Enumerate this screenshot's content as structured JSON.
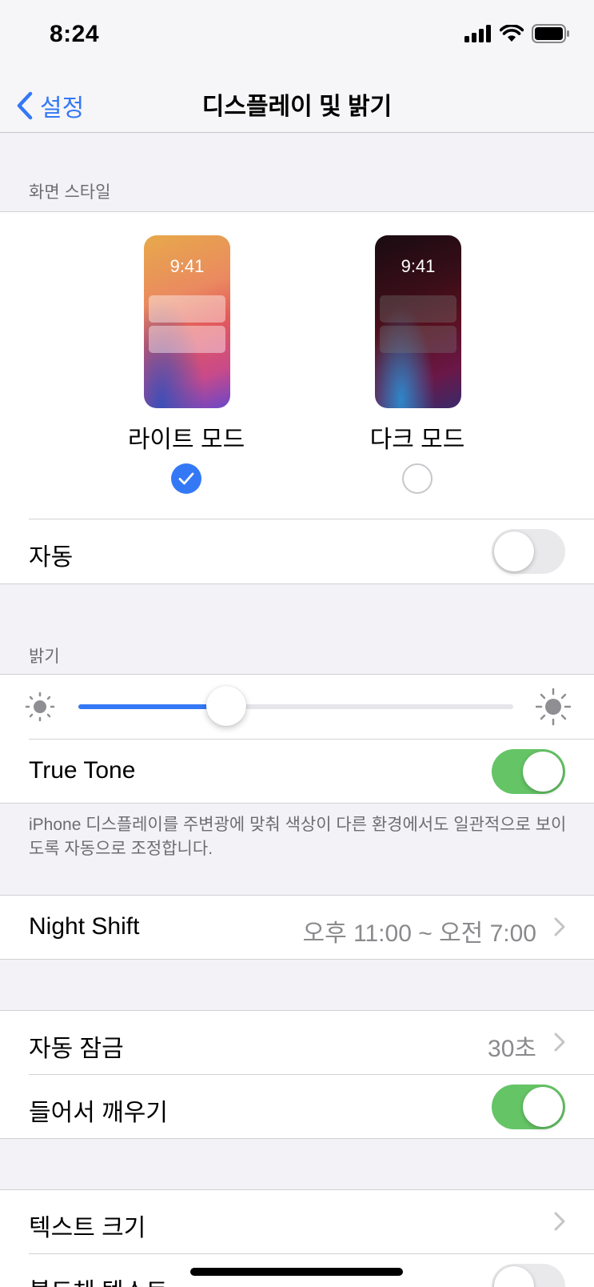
{
  "status_bar": {
    "time": "8:24",
    "icons": [
      "cellular-signal-icon",
      "wifi-icon",
      "battery-icon"
    ]
  },
  "nav": {
    "back_label": "설정",
    "title": "디스플레이 및 밝기"
  },
  "appearance": {
    "header": "화면 스타일",
    "light": {
      "preview_time": "9:41",
      "label": "라이트 모드",
      "selected": true
    },
    "dark": {
      "preview_time": "9:41",
      "label": "다크 모드",
      "selected": false
    },
    "auto": {
      "label": "자동",
      "on": false
    }
  },
  "brightness": {
    "header": "밝기",
    "level": 0.34,
    "true_tone": {
      "label": "True Tone",
      "on": true
    },
    "footer": "iPhone 디스플레이를 주변광에 맞춰 색상이 다른 환경에서도 일관적으로 보이도록 자동으로 조정합니다."
  },
  "night_shift": {
    "label": "Night Shift",
    "value": "오후 11:00 ~ 오전 7:00"
  },
  "lock": {
    "auto_lock": {
      "label": "자동 잠금",
      "value": "30초"
    },
    "raise_to_wake": {
      "label": "들어서 깨우기",
      "on": true
    }
  },
  "text": {
    "text_size": {
      "label": "텍스트 크기"
    },
    "bold_text": {
      "label": "볼드체 텍스트",
      "on": false
    }
  },
  "colors": {
    "accent": "#3478f6",
    "toggle_on": "#65c466",
    "toggle_off": "#e9e9eb"
  }
}
